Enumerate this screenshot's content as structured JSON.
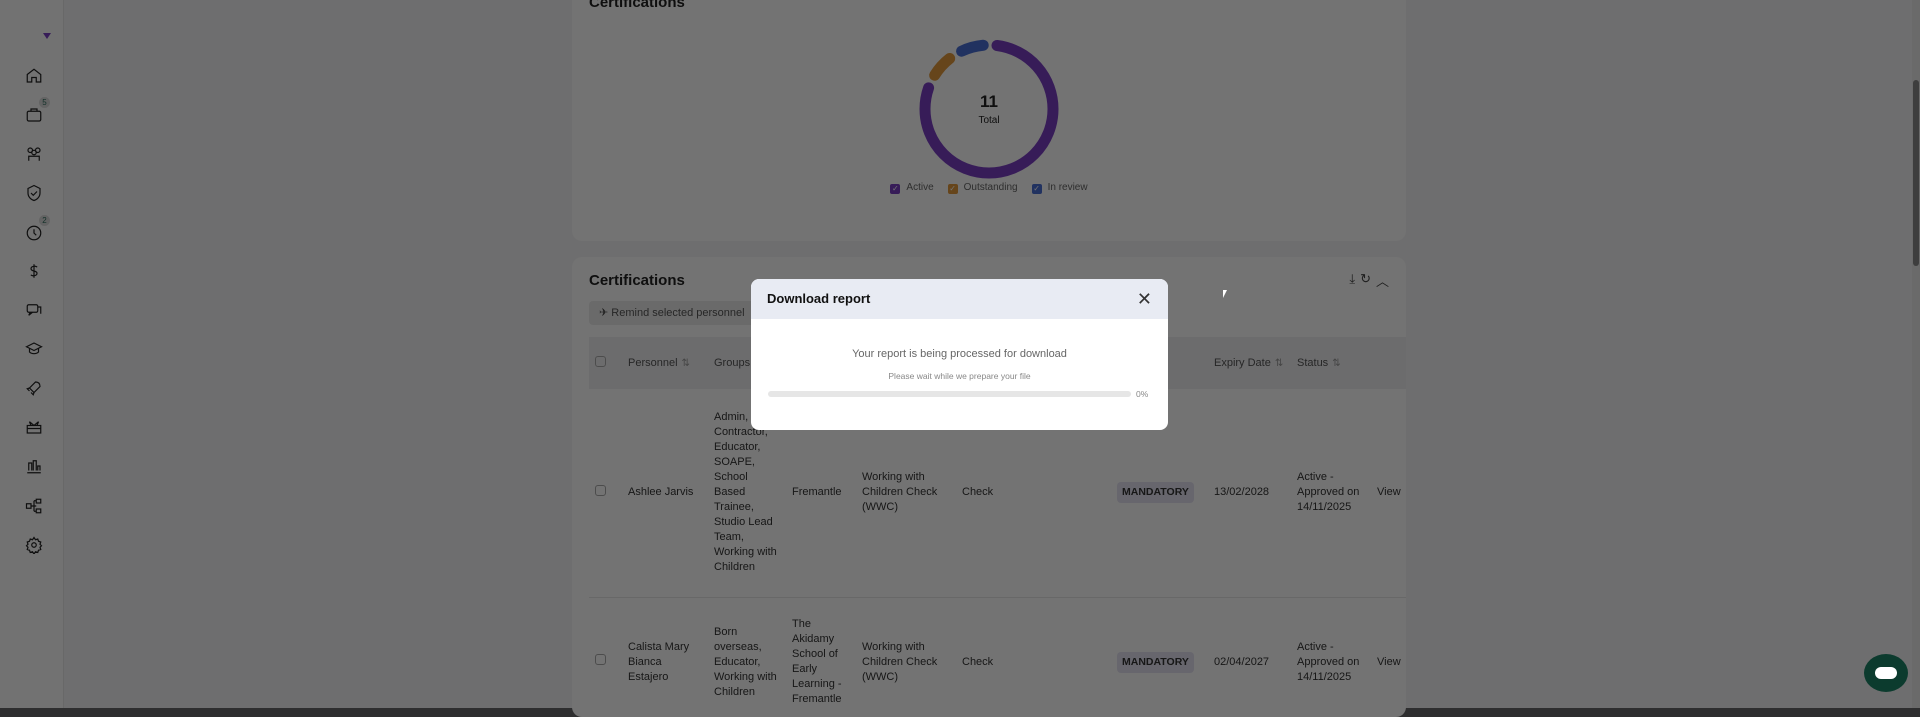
{
  "sidebar": {
    "items": [
      {
        "icon": "home-icon"
      },
      {
        "icon": "briefcase-search-icon",
        "badge": "5"
      },
      {
        "icon": "team-icon"
      },
      {
        "icon": "shield-check-icon"
      },
      {
        "icon": "clock-icon",
        "badge": "2"
      },
      {
        "icon": "dollar-icon"
      },
      {
        "icon": "chat-icon"
      },
      {
        "icon": "graduation-cap-icon"
      },
      {
        "icon": "rocket-icon"
      },
      {
        "icon": "gift-icon"
      },
      {
        "icon": "bar-chart-icon"
      },
      {
        "icon": "org-chart-icon"
      },
      {
        "icon": "gear-icon"
      }
    ]
  },
  "summary_card": {
    "title": "Certifications"
  },
  "chart_data": {
    "type": "pie",
    "title": "Certifications",
    "center_value": "11",
    "center_label": "Total",
    "categories": [
      "Active",
      "Outstanding",
      "In review"
    ],
    "values": [
      9,
      1,
      1
    ],
    "colors": [
      "#7b3fc4",
      "#e39a3c",
      "#4a6fd6"
    ],
    "legend": "bottom"
  },
  "table_card": {
    "title": "Certifications",
    "remind_label": "Remind selected personnel",
    "headers": {
      "personnel": "Personnel",
      "groups": "Groups",
      "expiry": "Expiry Date",
      "status": "Status"
    },
    "rows": [
      {
        "personnel": "Ashlee Jarvis",
        "groups": "Admin, Contractor, Educator, SOAPE, School Based Trainee, Studio Lead Team, Working with Children",
        "location": "Fremantle",
        "certification": "Working with Children Check (WWC)",
        "type": "Check",
        "category": "MANDATORY",
        "expiry": "13/02/2028",
        "status": "Active - Approved on 14/11/2025",
        "action": "View"
      },
      {
        "personnel": "Calista Mary Bianca Estajero",
        "groups": "Born overseas, Educator, Working with Children",
        "location": "The Akidamy School of Early Learning - Fremantle",
        "certification": "Working with Children Check (WWC)",
        "type": "Check",
        "category": "MANDATORY",
        "expiry": "02/04/2027",
        "status": "Active - Approved on 14/11/2025",
        "action": "View"
      }
    ]
  },
  "modal": {
    "title": "Download report",
    "message": "Your report is being processed for download",
    "submessage": "Please wait while we prepare your file",
    "progress": 0,
    "progress_label": "0%"
  }
}
